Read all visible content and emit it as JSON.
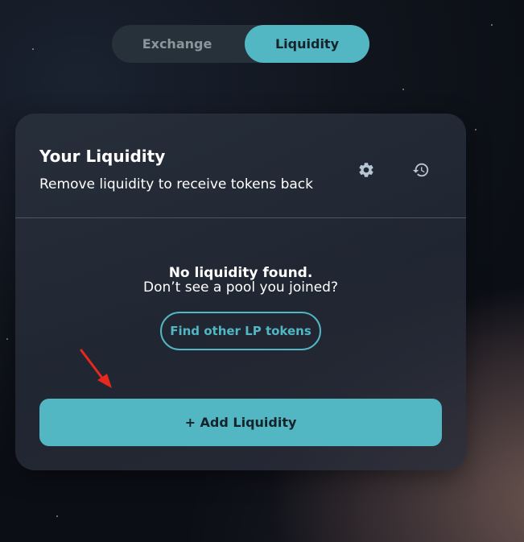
{
  "tabs": {
    "exchange": "Exchange",
    "liquidity": "Liquidity",
    "active": "liquidity"
  },
  "card": {
    "title": "Your Liquidity",
    "subtitle": "Remove liquidity to receive tokens back",
    "settings_icon": "gear-icon",
    "history_icon": "history-icon"
  },
  "empty_state": {
    "title": "No liquidity found.",
    "subtitle": "Don’t see a pool you joined?",
    "find_button": "Find other LP tokens"
  },
  "add_button": "+ Add Liquidity",
  "colors": {
    "accent": "#52b6c3",
    "annotation_arrow": "#e8281c"
  }
}
